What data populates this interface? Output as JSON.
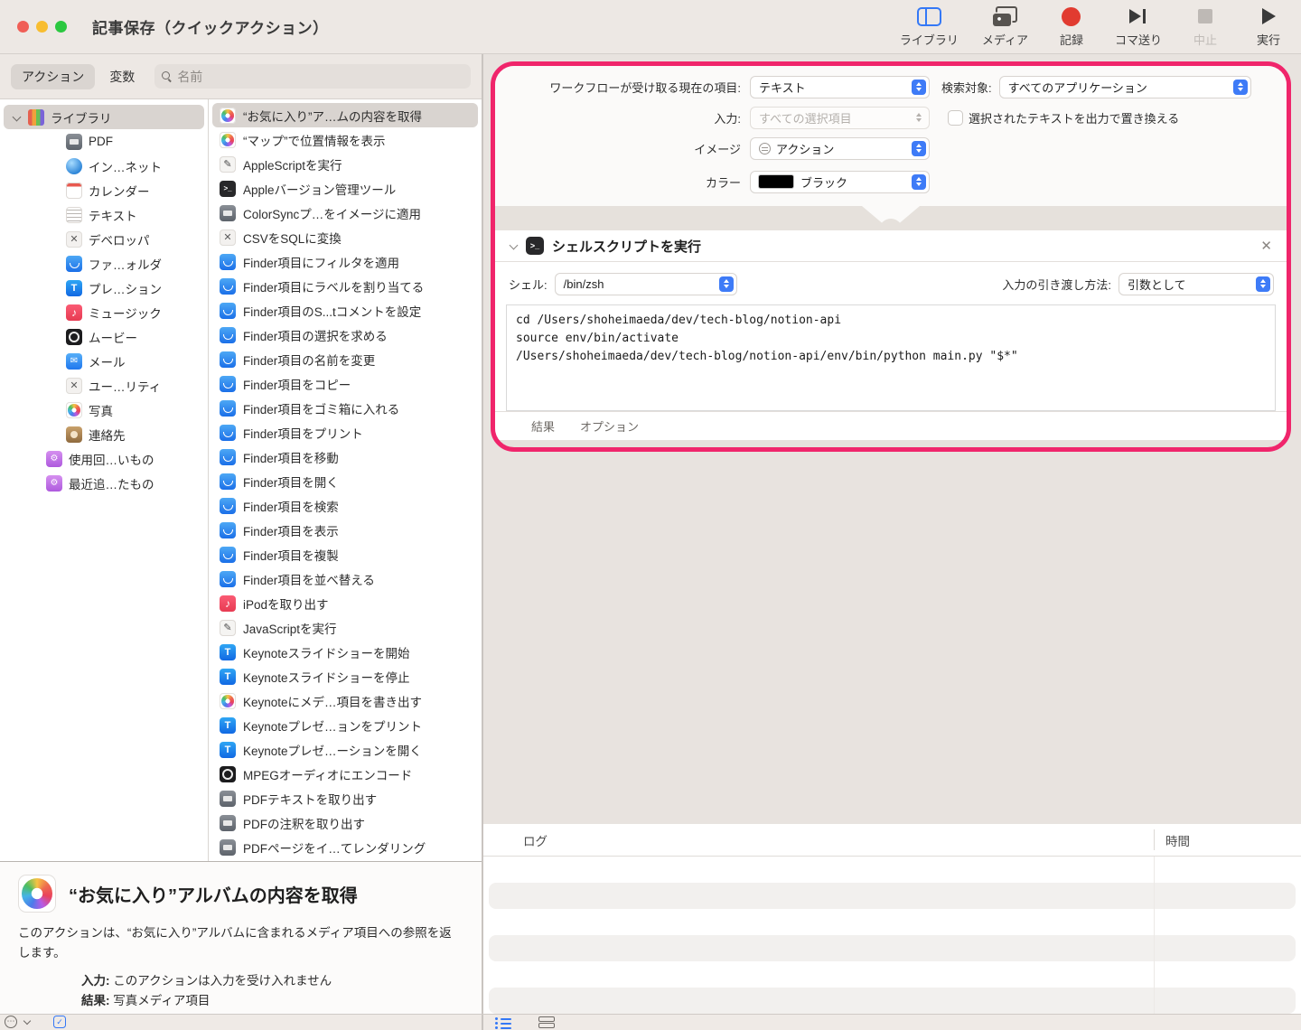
{
  "window": {
    "title": "記事保存（クイックアクション）"
  },
  "toolbar": {
    "items": [
      {
        "label": "ライブラリ",
        "icon": "library-panel",
        "cls": ""
      },
      {
        "label": "メディア",
        "icon": "media",
        "cls": ""
      },
      {
        "label": "記録",
        "icon": "record",
        "cls": ""
      },
      {
        "label": "コマ送り",
        "icon": "step-forward",
        "cls": ""
      },
      {
        "label": "中止",
        "icon": "stop",
        "cls": "disabled"
      },
      {
        "label": "実行",
        "icon": "run",
        "cls": ""
      }
    ]
  },
  "left": {
    "tabs": {
      "actions": "アクション",
      "variables": "変数"
    },
    "search_placeholder": "名前",
    "library": [
      {
        "label": "ライブラリ",
        "icon": "library",
        "cls": "selected",
        "disc": "show"
      },
      {
        "label": "PDF",
        "icon": "pdf",
        "cls": "depth1",
        "disc": ""
      },
      {
        "label": "イン…ネット",
        "icon": "globe",
        "cls": "depth1",
        "disc": ""
      },
      {
        "label": "カレンダー",
        "icon": "calendar",
        "cls": "depth1",
        "disc": ""
      },
      {
        "label": "テキスト",
        "icon": "text",
        "cls": "depth1",
        "disc": ""
      },
      {
        "label": "デベロッパ",
        "icon": "dev",
        "cls": "depth1",
        "disc": ""
      },
      {
        "label": "ファ…ォルダ",
        "icon": "finder",
        "cls": "depth1",
        "disc": ""
      },
      {
        "label": "プレ…ション",
        "icon": "keynote",
        "cls": "depth1",
        "disc": ""
      },
      {
        "label": "ミュージック",
        "icon": "music",
        "cls": "depth1",
        "disc": ""
      },
      {
        "label": "ムービー",
        "icon": "movie",
        "cls": "depth1",
        "disc": ""
      },
      {
        "label": "メール",
        "icon": "mail",
        "cls": "depth1",
        "disc": ""
      },
      {
        "label": "ユー…リティ",
        "icon": "utilities",
        "cls": "depth1",
        "disc": ""
      },
      {
        "label": "写真",
        "icon": "photos",
        "cls": "depth1",
        "disc": ""
      },
      {
        "label": "連絡先",
        "icon": "contacts",
        "cls": "depth1",
        "disc": ""
      },
      {
        "label": "使用回…いもの",
        "icon": "folder-smart",
        "cls": "smart",
        "disc": ""
      },
      {
        "label": "最近追…たもの",
        "icon": "folder-smart",
        "cls": "smart",
        "disc": ""
      }
    ],
    "actions": [
      {
        "label": "“お気に入り”ア…ムの内容を取得",
        "icon": "photos",
        "cls": "selected"
      },
      {
        "label": "“マップ”で位置情報を表示",
        "icon": "photos",
        "cls": ""
      },
      {
        "label": "AppleScriptを実行",
        "icon": "script",
        "cls": ""
      },
      {
        "label": "Appleバージョン管理ツール",
        "icon": "terminal",
        "cls": ""
      },
      {
        "label": "ColorSyncプ…をイメージに適用",
        "icon": "colorsync",
        "cls": ""
      },
      {
        "label": "CSVをSQLに変換",
        "icon": "utilities",
        "cls": ""
      },
      {
        "label": "Finder項目にフィルタを適用",
        "icon": "finder",
        "cls": ""
      },
      {
        "label": "Finder項目にラベルを割り当てる",
        "icon": "finder",
        "cls": ""
      },
      {
        "label": "Finder項目のS...tコメントを設定",
        "icon": "finder",
        "cls": ""
      },
      {
        "label": "Finder項目の選択を求める",
        "icon": "finder",
        "cls": ""
      },
      {
        "label": "Finder項目の名前を変更",
        "icon": "finder",
        "cls": ""
      },
      {
        "label": "Finder項目をコピー",
        "icon": "finder",
        "cls": ""
      },
      {
        "label": "Finder項目をゴミ箱に入れる",
        "icon": "finder",
        "cls": ""
      },
      {
        "label": "Finder項目をプリント",
        "icon": "finder",
        "cls": ""
      },
      {
        "label": "Finder項目を移動",
        "icon": "finder",
        "cls": ""
      },
      {
        "label": "Finder項目を開く",
        "icon": "finder",
        "cls": ""
      },
      {
        "label": "Finder項目を検索",
        "icon": "finder",
        "cls": ""
      },
      {
        "label": "Finder項目を表示",
        "icon": "finder",
        "cls": ""
      },
      {
        "label": "Finder項目を複製",
        "icon": "finder",
        "cls": ""
      },
      {
        "label": "Finder項目を並べ替える",
        "icon": "finder",
        "cls": ""
      },
      {
        "label": "iPodを取り出す",
        "icon": "ipod",
        "cls": ""
      },
      {
        "label": "JavaScriptを実行",
        "icon": "script",
        "cls": ""
      },
      {
        "label": "Keynoteスライドショーを開始",
        "icon": "keynote",
        "cls": ""
      },
      {
        "label": "Keynoteスライドショーを停止",
        "icon": "keynote",
        "cls": ""
      },
      {
        "label": "Keynoteにメデ…項目を書き出す",
        "icon": "photos",
        "cls": ""
      },
      {
        "label": "Keynoteプレゼ…ョンをプリント",
        "icon": "keynote",
        "cls": ""
      },
      {
        "label": "Keynoteプレゼ…ーションを開く",
        "icon": "keynote",
        "cls": ""
      },
      {
        "label": "MPEGオーディオにエンコード",
        "icon": "mpeg",
        "cls": ""
      },
      {
        "label": "PDFテキストを取り出す",
        "icon": "pdf",
        "cls": ""
      },
      {
        "label": "PDFの注釈を取り出す",
        "icon": "pdf",
        "cls": ""
      },
      {
        "label": "PDFページをイ…てレンダリング",
        "icon": "pdf",
        "cls": ""
      }
    ],
    "description": {
      "title": "“お気に入り”アルバムの内容を取得",
      "body": "このアクションは、“お気に入り”アルバムに含まれるメディア項目への参照を返します。",
      "input_label": "入力:",
      "input_text": "このアクションは入力を受け入れません",
      "result_label": "結果:",
      "result_text": "写真メディア項目"
    }
  },
  "workflow": {
    "highlight_color": "#F0256B",
    "receives_label": "ワークフローが受け取る現在の項目:",
    "receives_value": "テキスト",
    "target_label": "検索対象:",
    "target_value": "すべてのアプリケーション",
    "input_label": "入力:",
    "input_value": "すべての選択項目",
    "replace_checkbox_label": "選択されたテキストを出力で置き換える",
    "image_label": "イメージ",
    "image_value": "アクション",
    "color_label": "カラー",
    "color_value": "ブラック",
    "color_swatch": "#000000",
    "shell_action": {
      "title": "シェルスクリプトを実行",
      "shell_label": "シェル:",
      "shell_value": "/bin/zsh",
      "pass_label": "入力の引き渡し方法:",
      "pass_value": "引数として",
      "code_lines": [
        "cd /Users/shoheimaeda/dev/tech-blog/notion-api",
        "source env/bin/activate",
        "/Users/shoheimaeda/dev/tech-blog/notion-api/env/bin/python main.py \"$*\""
      ],
      "footer_result": "結果",
      "footer_options": "オプション"
    }
  },
  "log": {
    "col_log": "ログ",
    "col_time": "時間"
  }
}
